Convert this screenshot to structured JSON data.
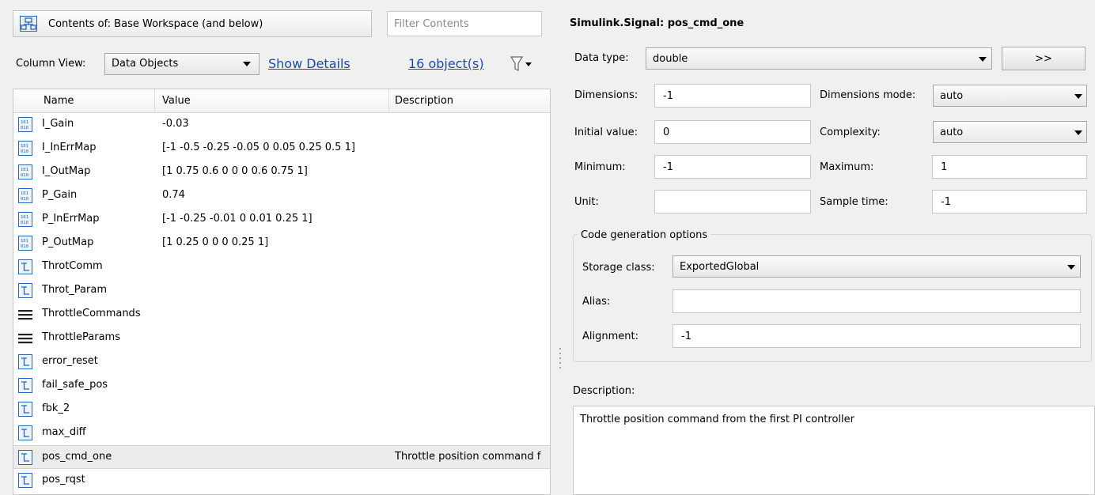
{
  "workspace": {
    "title": "Contents of:  Base Workspace  (and below)",
    "filter_placeholder": "Filter Contents",
    "column_view_label": "Column View:",
    "column_view_value": "Data Objects",
    "show_details": "Show Details",
    "object_count": "16 object(s)",
    "columns": [
      "Name",
      "Value",
      "Description"
    ],
    "rows": [
      {
        "icon": "parameter-icon",
        "name": "I_Gain",
        "value": "-0.03",
        "description": ""
      },
      {
        "icon": "parameter-icon",
        "name": "I_InErrMap",
        "value": "[-1 -0.5 -0.25 -0.05 0 0.05 0.25 0.5 1]",
        "description": ""
      },
      {
        "icon": "parameter-icon",
        "name": "I_OutMap",
        "value": "[1 0.75 0.6 0 0 0 0.6 0.75 1]",
        "description": ""
      },
      {
        "icon": "parameter-icon",
        "name": "P_Gain",
        "value": "0.74",
        "description": ""
      },
      {
        "icon": "parameter-icon",
        "name": "P_InErrMap",
        "value": "[-1 -0.25 -0.01 0 0.01 0.25 1]",
        "description": ""
      },
      {
        "icon": "parameter-icon",
        "name": "P_OutMap",
        "value": "[1 0.25 0 0 0 0.25 1]",
        "description": ""
      },
      {
        "icon": "signal-icon",
        "name": "ThrotComm",
        "value": "",
        "description": ""
      },
      {
        "icon": "signal-icon",
        "name": "Throt_Param",
        "value": "",
        "description": ""
      },
      {
        "icon": "bus-icon",
        "name": "ThrottleCommands",
        "value": "",
        "description": ""
      },
      {
        "icon": "bus-icon",
        "name": "ThrottleParams",
        "value": "",
        "description": ""
      },
      {
        "icon": "signal-icon",
        "name": "error_reset",
        "value": "",
        "description": ""
      },
      {
        "icon": "signal-icon",
        "name": "fail_safe_pos",
        "value": "",
        "description": ""
      },
      {
        "icon": "signal-icon",
        "name": "fbk_2",
        "value": "",
        "description": ""
      },
      {
        "icon": "signal-icon",
        "name": "max_diff",
        "value": "",
        "description": ""
      },
      {
        "icon": "signal-icon",
        "name": "pos_cmd_one",
        "value": "",
        "description": "Throttle position command f",
        "selected": true
      },
      {
        "icon": "signal-icon",
        "name": "pos_rqst",
        "value": "",
        "description": ""
      }
    ]
  },
  "properties": {
    "title": "Simulink.Signal: pos_cmd_one",
    "data_type_label": "Data type:",
    "data_type_value": "double",
    "more_button": ">>",
    "dimensions_label": "Dimensions:",
    "dimensions_value": "-1",
    "dimensions_mode_label": "Dimensions mode:",
    "dimensions_mode_value": "auto",
    "initial_value_label": "Initial value:",
    "initial_value": "0",
    "complexity_label": "Complexity:",
    "complexity_value": "auto",
    "minimum_label": "Minimum:",
    "minimum_value": "-1",
    "maximum_label": "Maximum:",
    "maximum_value": "1",
    "unit_label": "Unit:",
    "unit_value": "",
    "sample_time_label": "Sample time:",
    "sample_time_value": "-1",
    "codegen_title": "Code generation options",
    "storage_class_label": "Storage class:",
    "storage_class_value": "ExportedGlobal",
    "alias_label": "Alias:",
    "alias_value": "",
    "alignment_label": "Alignment:",
    "alignment_value": "-1",
    "description_label": "Description:",
    "description_value": "Throttle position command from the first PI controller"
  },
  "colors": {
    "link": "#1f48b5",
    "icon_blue": "#2a66b4",
    "selected_row": "#ececec"
  }
}
